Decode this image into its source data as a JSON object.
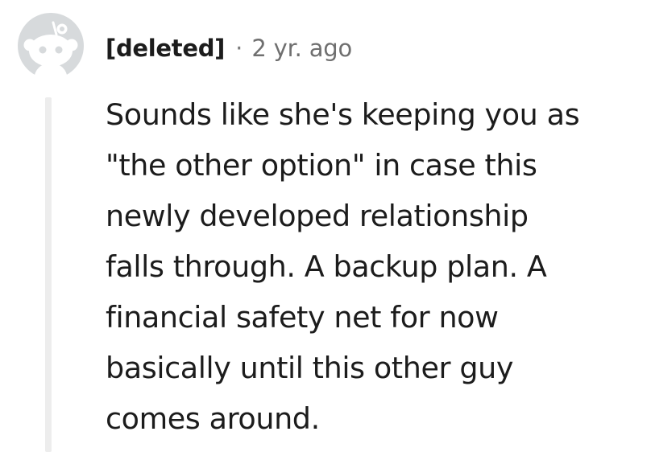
{
  "comment": {
    "author": "[deleted]",
    "separator": "·",
    "timestamp": "2 yr. ago",
    "avatar_icon": "default-reddit-avatar-icon",
    "body_lines": [
      "Sounds like she's keeping you as",
      "\"the other option\" in case this",
      "newly developed relationship",
      "falls through. A backup plan. A",
      "financial safety net for now",
      "basically until this other guy",
      "comes around."
    ]
  },
  "colors": {
    "avatar_background": "#d7dadc",
    "avatar_foreground": "#ffffff",
    "thread_line": "#ededed",
    "text_primary": "#1c1c1c",
    "text_meta": "#6f6f6f"
  }
}
